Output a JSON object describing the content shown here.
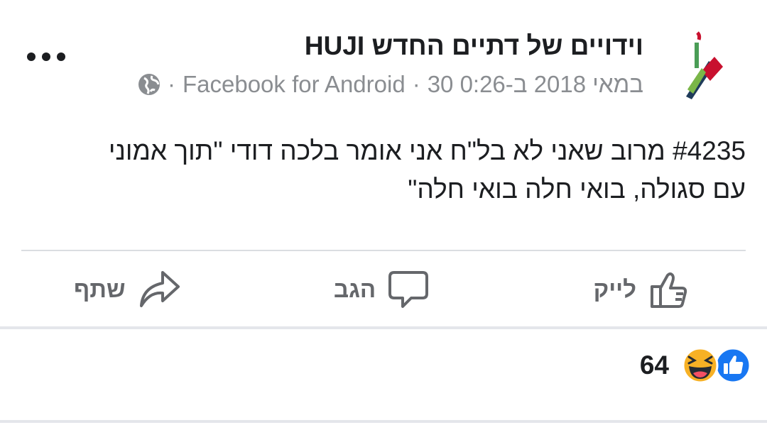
{
  "post": {
    "page_name": "וידויים של דתיים החדש HUJI",
    "date": "30 במאי 2018 ב-0:26",
    "source": "Facebook for Android",
    "separator": "·",
    "text_line1": "#4235 מרוב שאני לא בל\"ח אני אומר בלכה דודי \"תוך אמוני",
    "text_line2": "עם סגולה, בואי חלה בואי חלה\"",
    "privacy_icon": "globe-icon",
    "avatar_icon": "huji-logo"
  },
  "actions": {
    "like_label": "לייק",
    "comment_label": "הגב",
    "share_label": "שתף"
  },
  "reactions": {
    "count": "64",
    "icons": [
      "haha-icon",
      "like-reaction-icon"
    ]
  },
  "colors": {
    "text": "#1c1e21",
    "secondary": "#65676b",
    "meta": "#8a8d91",
    "like_blue": "#1877f2",
    "haha_yellow": "#f7b125"
  }
}
